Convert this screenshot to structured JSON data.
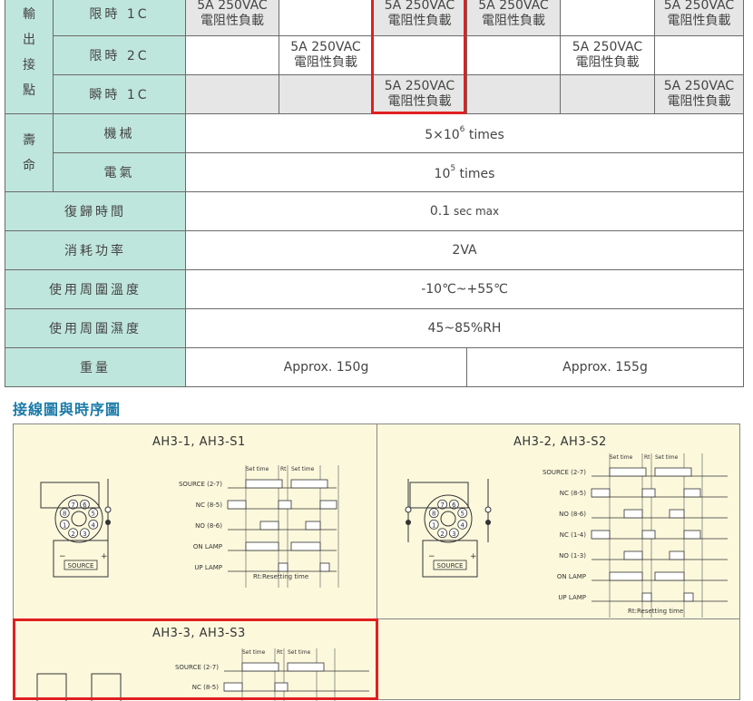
{
  "spec_table": {
    "output_group": "輸出接點",
    "rows": {
      "limit_1c": {
        "label": "限時 1C",
        "cells": [
          "5A 250VAC|電阻性負載",
          "",
          "5A 250VAC|電阻性負載",
          "5A 250VAC|電阻性負載",
          "",
          "5A 250VAC|電阻性負載"
        ]
      },
      "limit_2c": {
        "label": "限時 2C",
        "cells": [
          "",
          "5A 250VAC|電阻性負載",
          "",
          "",
          "5A 250VAC|電阻性負載",
          ""
        ]
      },
      "instant_1c": {
        "label": "瞬時 1C",
        "cells": [
          "",
          "",
          "5A 250VAC|電阻性負載",
          "",
          "",
          "5A 250VAC|電阻性負載"
        ]
      }
    },
    "life_group": "壽命",
    "mechanical": {
      "label": "機械",
      "value_prefix": "5×10",
      "value_exp": "6",
      "value_suffix": " times"
    },
    "electrical": {
      "label": "電氣",
      "value_prefix": "10",
      "value_exp": "5",
      "value_suffix": " times"
    },
    "reset_time": {
      "label": "復歸時間",
      "value_main": "0.1",
      "value_unit": " sec max"
    },
    "power": {
      "label": "消耗功率",
      "value": "2VA"
    },
    "temperature": {
      "label": "使用周圍溫度",
      "value": "-10℃~+55℃"
    },
    "humidity": {
      "label": "使用周圍濕度",
      "value": "45~85%RH"
    },
    "weight": {
      "label": "重量",
      "value_a": "Approx. 150g",
      "value_b": "Approx. 155g"
    }
  },
  "section_title": "接線圖與時序圖",
  "diagrams": {
    "d1": {
      "title": "AH3-1, AH3-S1",
      "signals": [
        "SOURCE (2-7)",
        "NC (8-5)",
        "NO (8-6)",
        "ON LAMP",
        "UP LAMP"
      ],
      "set_time": "Set time",
      "rt": "Rt",
      "footer": "Rt:Resetting time",
      "source_label": "SOURCE",
      "pins": [
        "1",
        "2",
        "3",
        "4",
        "5",
        "6",
        "7",
        "8"
      ]
    },
    "d2": {
      "title": "AH3-2, AH3-S2",
      "signals": [
        "SOURCE (2-7)",
        "NC (8-5)",
        "NO (8-6)",
        "NC (1-4)",
        "NO (1-3)",
        "ON LAMP",
        "UP LAMP"
      ],
      "set_time": "Set time",
      "rt": "Rt",
      "footer": "Rt:Resetting time",
      "source_label": "SOURCE",
      "pins": [
        "1",
        "2",
        "3",
        "4",
        "5",
        "6",
        "7",
        "8"
      ]
    },
    "d3": {
      "title": "AH3-3, AH3-S3",
      "signals": [
        "SOURCE (2-7)",
        "NC (8-5)"
      ],
      "set_time": "Set time",
      "rt": "Rt"
    }
  },
  "colors": {
    "header_bg": "#bfe6dc",
    "highlight": "#e02020",
    "panel_bg": "#fbf8dc",
    "title": "#1b7aa8",
    "gray_cell": "#e6e6e6"
  }
}
